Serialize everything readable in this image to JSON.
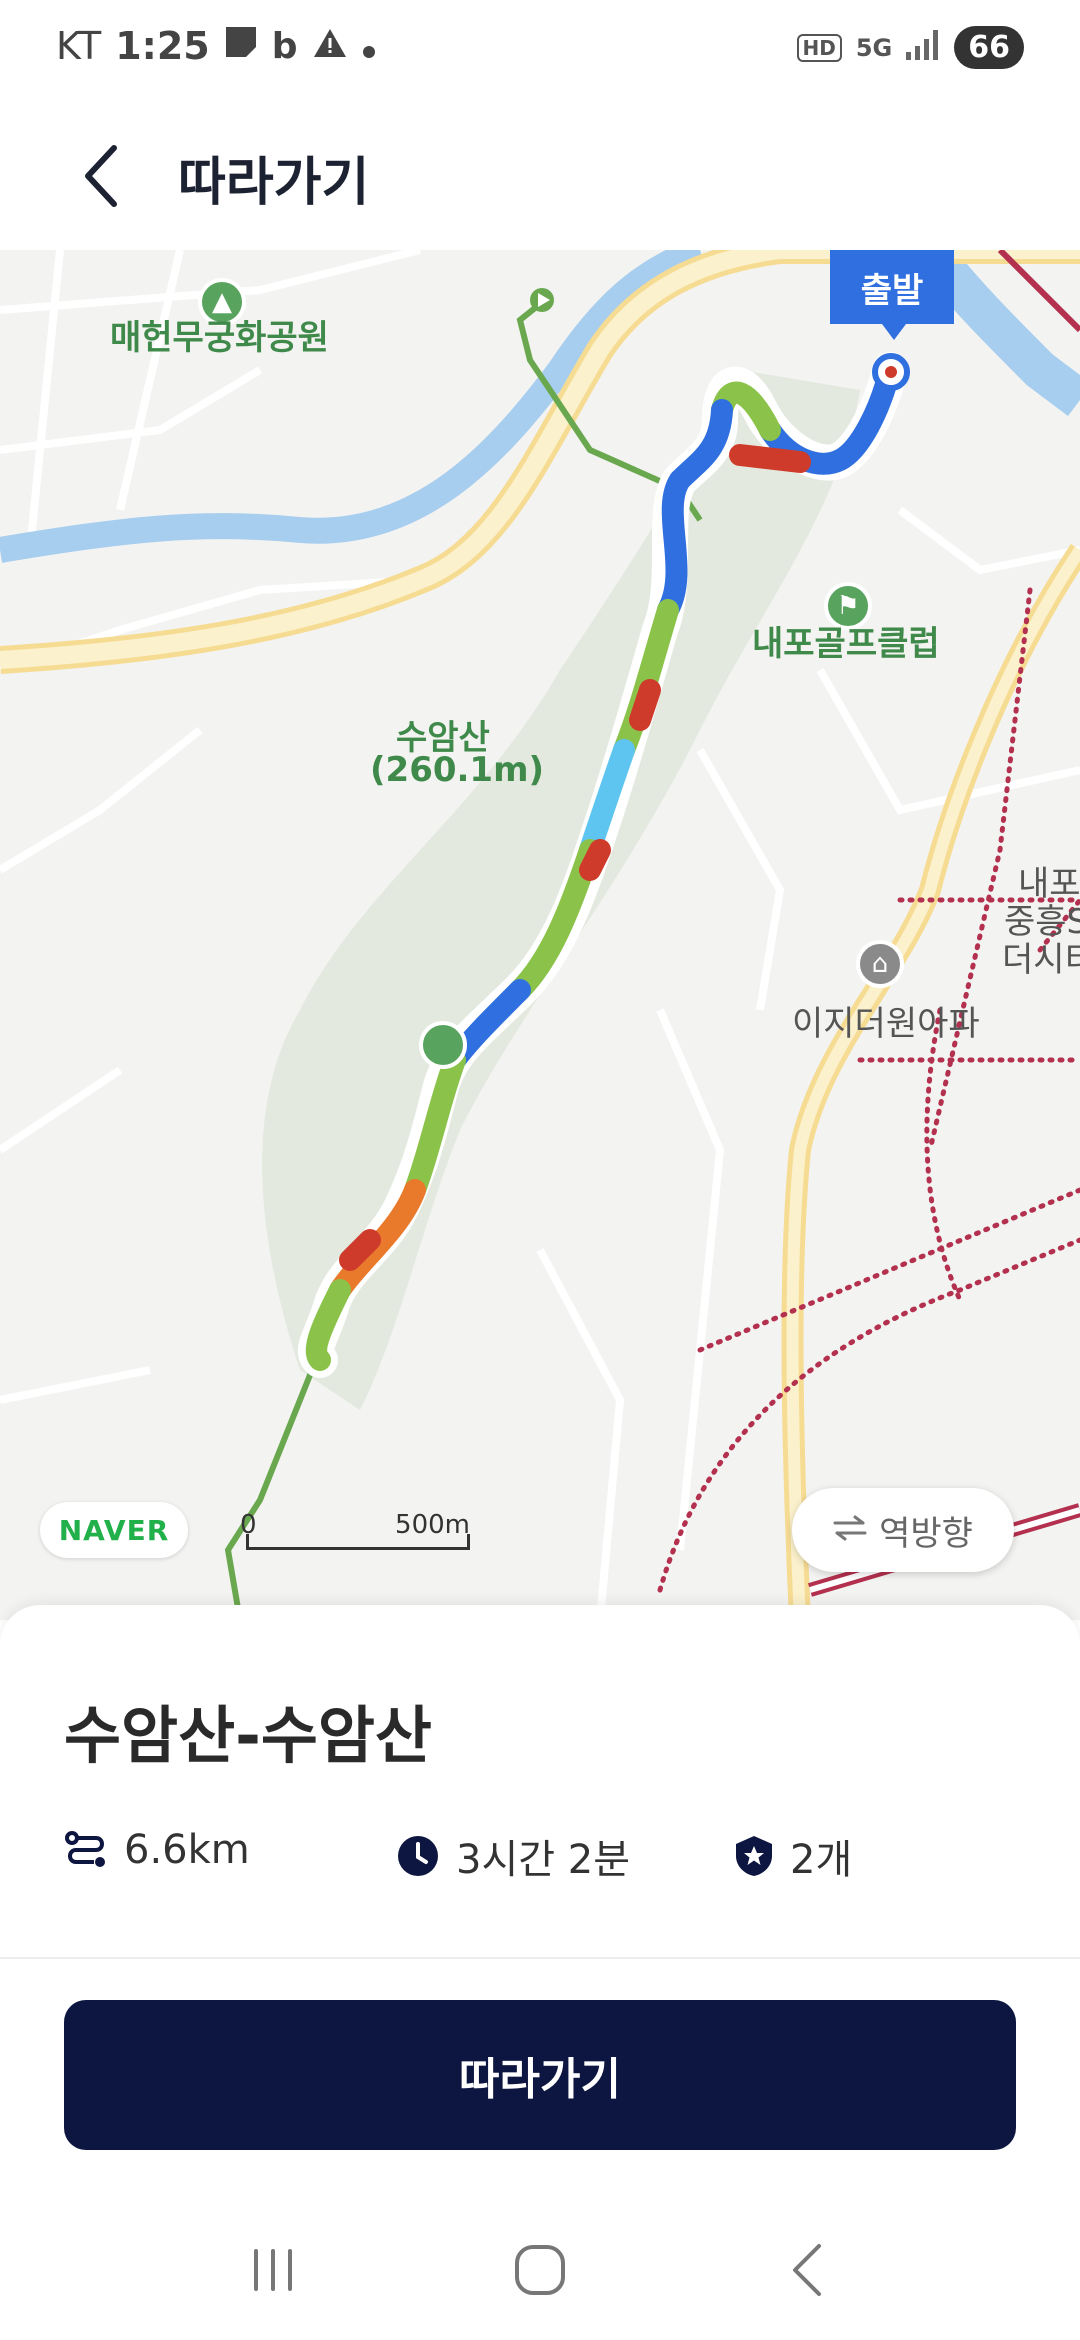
{
  "status_bar": {
    "carrier": "KT",
    "time": "1:25",
    "hd": "HD",
    "network": "5G",
    "battery": "66"
  },
  "header": {
    "title": "따라가기"
  },
  "map": {
    "start_label": "출발",
    "poi": {
      "park": "매헌무궁화공원",
      "golf": "내포골프클럽",
      "peak_name": "수암산",
      "peak_height": "(260.1m)",
      "town_1": "내포",
      "town_2": "중흥S",
      "town_3": "더시티",
      "apartment": "이지더원아파"
    },
    "logo": "NAVER",
    "scale": {
      "zero": "0",
      "max": "500m"
    },
    "reverse_button": "역방향"
  },
  "route": {
    "name": "수암산-수암산",
    "distance": "6.6km",
    "duration": "3시간 2분",
    "badge_count": "2개"
  },
  "actions": {
    "follow_label": "따라가기"
  },
  "icons": {
    "back": "back-arrow-icon",
    "distance": "route-icon",
    "time": "clock-icon",
    "count": "shield-star-icon"
  },
  "colors": {
    "primary": "#0d1640",
    "start_badge": "#2f6fe0",
    "map_green_label": "#3f8a4a"
  }
}
